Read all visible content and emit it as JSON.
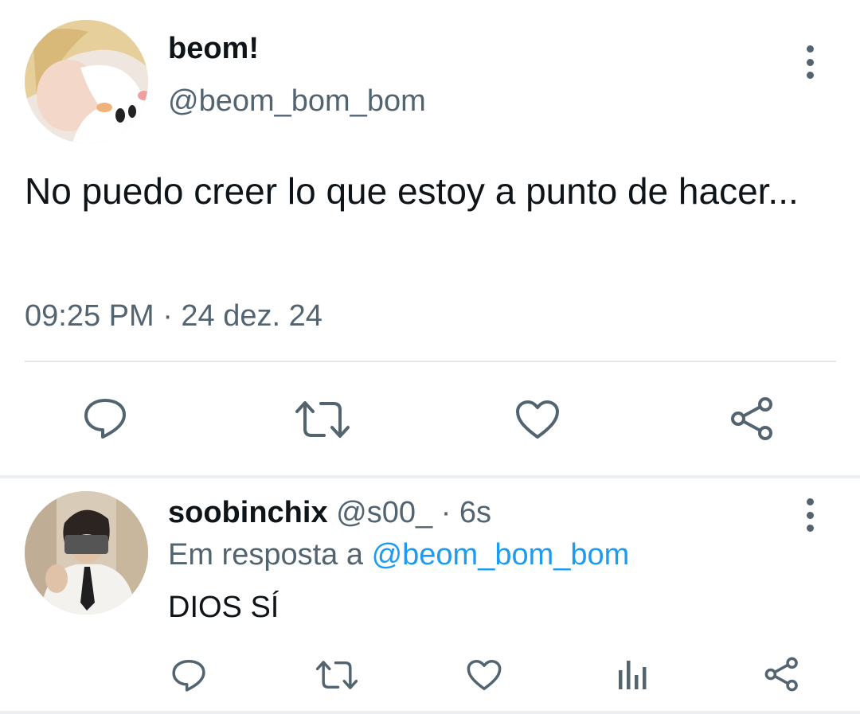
{
  "main_tweet": {
    "avatar_icon": "user-avatar-photo",
    "display_name": "beom!",
    "handle": "@beom_bom_bom",
    "text": "No puedo creer lo que estoy a punto de hacer...",
    "timestamp": "09:25 PM · 24 dez. 24",
    "actions": [
      "reply-icon",
      "retweet-icon",
      "like-icon",
      "share-icon"
    ]
  },
  "reply_tweet": {
    "avatar_icon": "user-avatar-photo",
    "display_name": "soobinchix",
    "handle": "@s00_",
    "separator": "·",
    "time": "6s",
    "reply_prefix": "Em resposta a",
    "reply_mention": "@beom_bom_bom",
    "text": "DIOS SÍ",
    "actions": [
      "reply-icon",
      "retweet-icon",
      "like-icon",
      "analytics-icon",
      "share-icon"
    ]
  },
  "colors": {
    "text_primary": "#0f1419",
    "text_secondary": "#536471",
    "link": "#1d9bf0",
    "divider": "#e3e7ea"
  }
}
